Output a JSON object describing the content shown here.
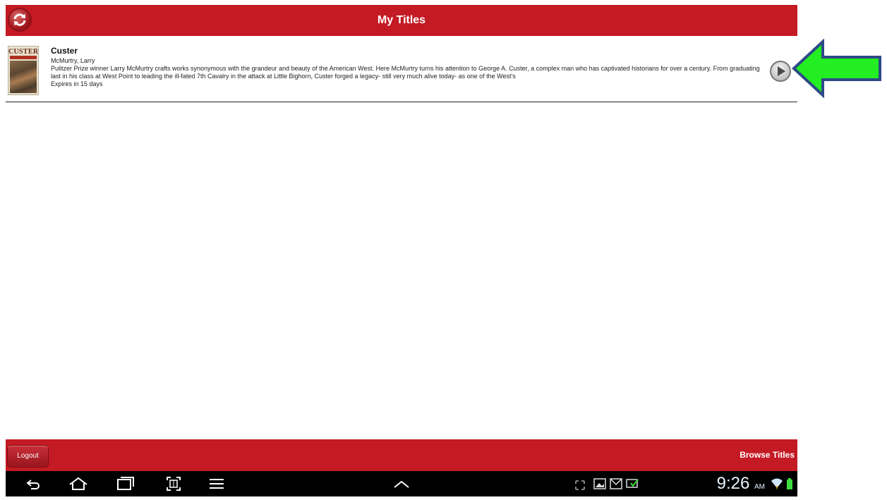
{
  "header": {
    "title": "My Titles"
  },
  "titles": [
    {
      "cover_title": "CUSTER",
      "title": "Custer",
      "author": "McMurtry, Larry",
      "description": "Pulitzer Prize winner Larry McMurtry crafts works synonymous with the grandeur and beauty of the American West. Here McMurtry turns his attention to George A. Custer, a complex man who has captivated historians for over a century. From graduating last in his class at West Point to leading the ill-fated 7th Cavalry in the attack at Little Bighorn, Custer forged a legacy- still very much alive today- as one of the West's",
      "expires": "Expires in 15 days"
    }
  ],
  "footer": {
    "logout_label": "Logout",
    "browse_label": "Browse Titles"
  },
  "status_bar": {
    "time": "9:26",
    "ampm": "AM"
  },
  "icons": {
    "refresh": "refresh-icon",
    "play": "play-icon",
    "back": "back-icon",
    "home": "home-icon",
    "recents": "recent-apps-icon",
    "screenshot": "screen-capture-icon",
    "menu": "menu-icon",
    "up": "chevron-up-icon"
  },
  "colors": {
    "brand_red": "#c41a24",
    "callout_green": "#22ee22",
    "callout_border": "#2e4a86"
  }
}
